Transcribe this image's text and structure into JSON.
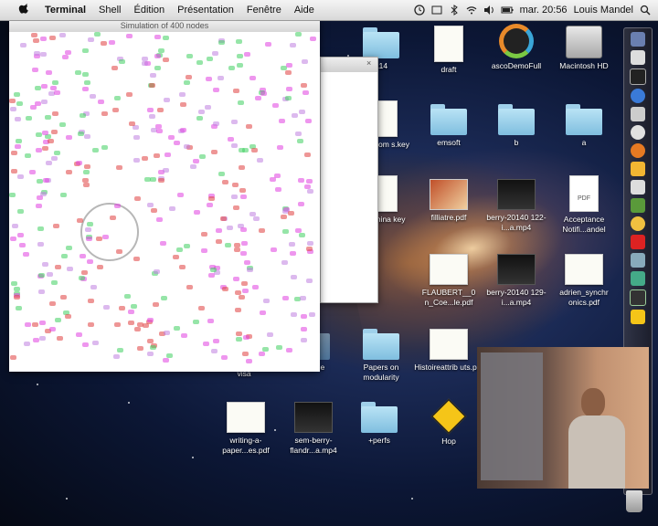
{
  "menubar": {
    "app_name": "Terminal",
    "menus": [
      "Shell",
      "Édition",
      "Présentation",
      "Fenêtre",
      "Aide"
    ],
    "clock": "mar. 20:56",
    "user": "Louis Mandel"
  },
  "sim_window": {
    "title": "Simulation of 400 nodes"
  },
  "desktop_icons": [
    {
      "label": "a14"
    },
    {
      "label": "draft"
    },
    {
      "label": "ascoDemoFull"
    },
    {
      "label": "Macintosh HD"
    },
    {
      "label": "es_com s.key"
    },
    {
      "label": "emsoft"
    },
    {
      "label": "b"
    },
    {
      "label": "a"
    },
    {
      "label": "semina key"
    },
    {
      "label": "filliatre.pdf"
    },
    {
      "label": "berry-20140 122-i...a.mp4"
    },
    {
      "label": "Acceptance Notifi...andel"
    },
    {
      "label": "FLAUBERT__0 n_Coe...le.pdf"
    },
    {
      "label": "berry-20140 129-i...a.mp4"
    },
    {
      "label": "adrien_synchr onics.pdf"
    },
    {
      "label": "visa"
    },
    {
      "label": "resume"
    },
    {
      "label": "Papers on modularity"
    },
    {
      "label": "Histoireattrib uts.pdf"
    },
    {
      "label": "writing-a- paper...es.pdf"
    },
    {
      "label": "sem-berry- flandr...a.mp4"
    },
    {
      "label": "+perfs"
    },
    {
      "label": "Hop"
    }
  ],
  "colors": {
    "menubar_bg": "#e6e6e6",
    "folder": "#9fd0ea",
    "desktop": "#0c1736"
  },
  "icons": [
    "apple-icon",
    "time-machine-icon",
    "wifi-icon",
    "volume-icon",
    "battery-icon",
    "spotlight-icon"
  ]
}
